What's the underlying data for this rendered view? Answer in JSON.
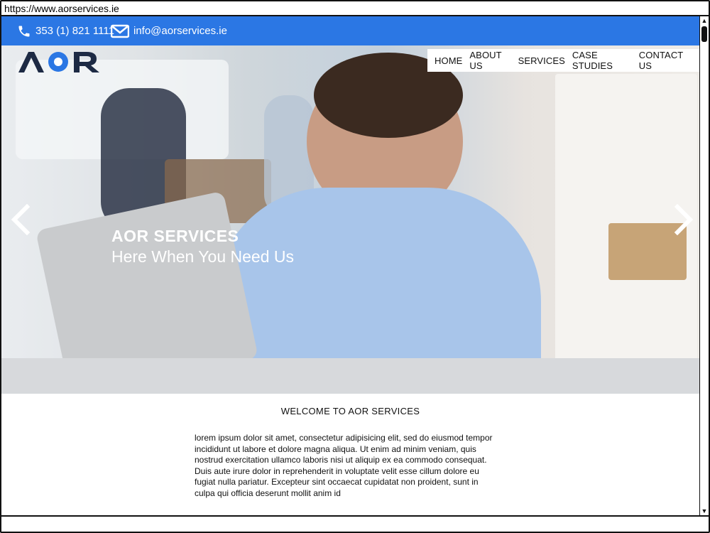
{
  "browser": {
    "url": "https://www.aorservices.ie"
  },
  "topbar": {
    "phone": "353 (1) 821 1111",
    "email": "info@aorservices.ie",
    "phone_icon": "phone-icon",
    "email_icon": "envelope-icon",
    "color": "#2b77e4"
  },
  "header": {
    "logo_text": "AOR",
    "nav": [
      {
        "label": "HOME"
      },
      {
        "label": "ABOUT US"
      },
      {
        "label": "SERVICES"
      },
      {
        "label": "CASE STUDIES"
      },
      {
        "label": "CONTACT US"
      }
    ]
  },
  "hero": {
    "title": "AOR SERVICES",
    "subtitle": "Here When You Need Us",
    "prev_icon": "chevron-left-icon",
    "next_icon": "chevron-right-icon"
  },
  "welcome": {
    "heading": "WELCOME TO AOR SERVICES",
    "body": "lorem ipsum dolor sit amet, consectetur adipisicing elit, sed do eiusmod tempor incididunt ut labore et dolore magna aliqua. Ut enim ad minim veniam, quis nostrud exercitation ullamco laboris nisi ut aliquip ex ea commodo consequat. Duis aute irure dolor in reprehenderit in voluptate velit esse cillum dolore eu fugiat nulla pariatur. Excepteur sint occaecat cupidatat non proident, sunt in culpa qui officia deserunt mollit anim id"
  }
}
